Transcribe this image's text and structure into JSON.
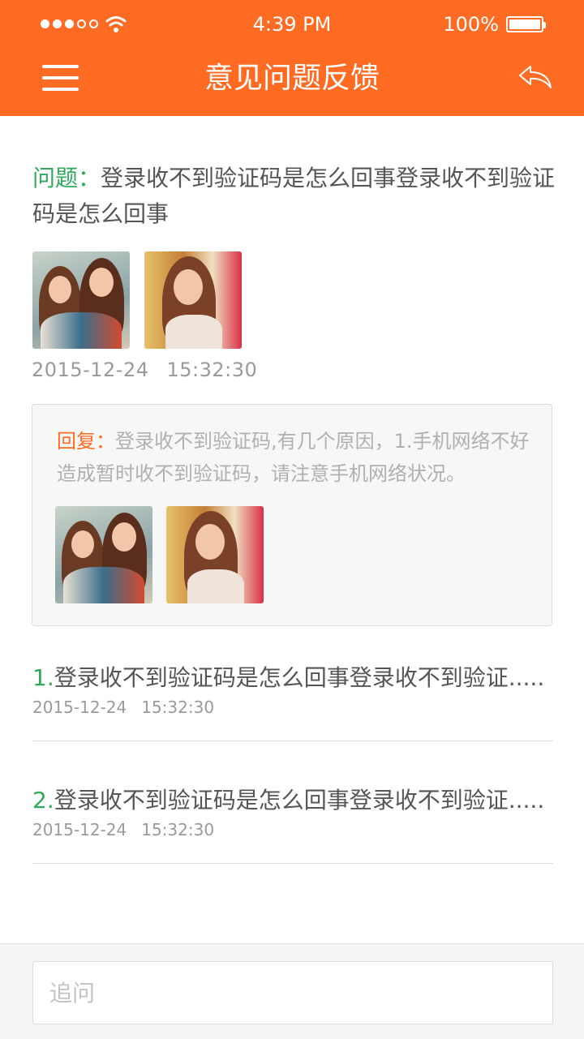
{
  "status_bar": {
    "time": "4:39 PM",
    "battery": "100%"
  },
  "header": {
    "title": "意见问题反馈",
    "menu_icon": "menu-icon",
    "back_icon": "reply-arrow-icon"
  },
  "question": {
    "label": "问题：",
    "text": "登录收不到验证码是怎么回事登录收不到验证码是怎么回事",
    "date": "2015-12-24",
    "time": "15:32:30",
    "images": [
      "two-women-photo",
      "woman-portrait-photo"
    ]
  },
  "reply": {
    "label": "回复：",
    "text": "登录收不到验证码,有几个原因，1.手机网络不好造成暂时收不到验证码，请注意手机网络状况。",
    "images": [
      "two-women-photo",
      "woman-portrait-photo"
    ]
  },
  "history": [
    {
      "index": "1.",
      "title": "登录收不到验证码是怎么回事登录收不到验证.....",
      "date": "2015-12-24",
      "time": "15:32:30"
    },
    {
      "index": "2.",
      "title": "登录收不到验证码是怎么回事登录收不到验证.....",
      "date": "2015-12-24",
      "time": "15:32:30"
    }
  ],
  "footer": {
    "placeholder": "追问"
  },
  "colors": {
    "accent": "#ff6b22",
    "label_green": "#2eaa5a",
    "reply_orange": "#ff6b22"
  }
}
